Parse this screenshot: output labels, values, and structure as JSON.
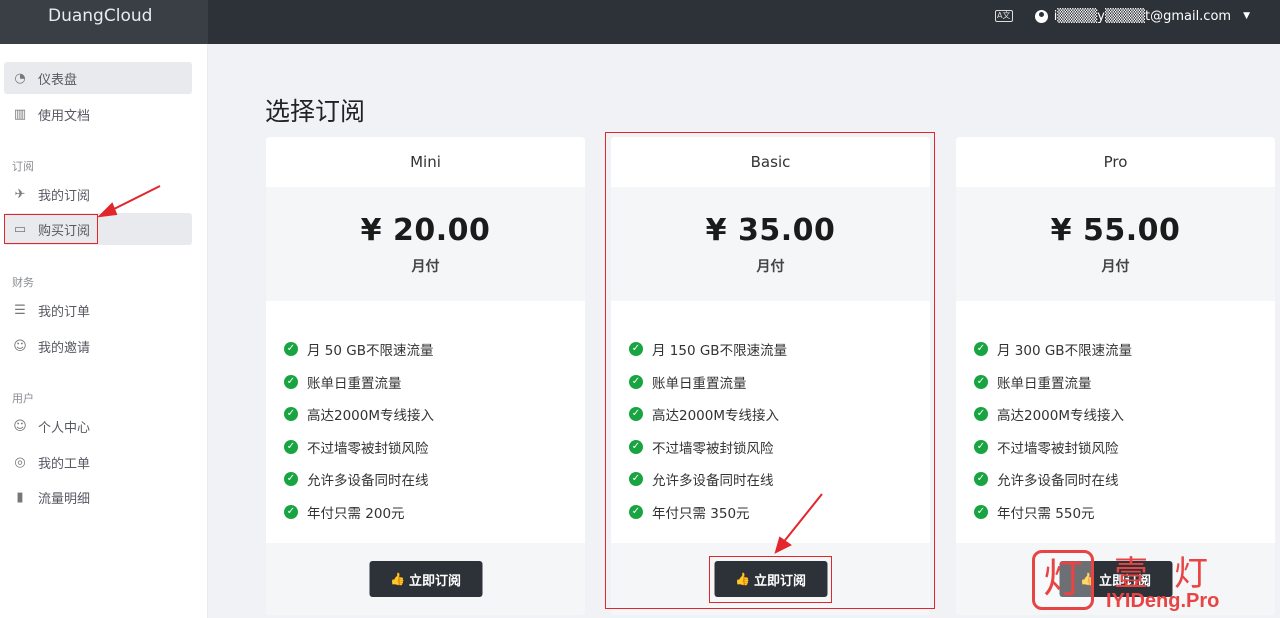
{
  "app": {
    "brand": "DuangCloud"
  },
  "header": {
    "lang_icon": "A文",
    "user_email": "i▒▒▒▒y▒▒▒▒t@gmail.com",
    "caret": "▼"
  },
  "sidebar": {
    "items": [
      {
        "label": "仪表盘",
        "icon": "gauge-icon",
        "glyph": "◔"
      },
      {
        "label": "使用文档",
        "icon": "book-icon",
        "glyph": "▥"
      },
      {
        "label": "我的订阅",
        "icon": "rocket-icon",
        "glyph": "✈"
      },
      {
        "label": "购买订阅",
        "icon": "clipboard-icon",
        "glyph": "▭"
      },
      {
        "label": "我的订单",
        "icon": "list-icon",
        "glyph": "☰"
      },
      {
        "label": "我的邀请",
        "icon": "users-icon",
        "glyph": "☺"
      },
      {
        "label": "个人中心",
        "icon": "user-icon",
        "glyph": "☺"
      },
      {
        "label": "我的工单",
        "icon": "support-icon",
        "glyph": "◎"
      },
      {
        "label": "流量明细",
        "icon": "bar-chart-icon",
        "glyph": "▮"
      }
    ],
    "sections": [
      "订阅",
      "财务",
      "用户"
    ]
  },
  "main": {
    "title": "选择订阅",
    "plans": [
      {
        "name": "Mini",
        "price": "¥ 20.00",
        "cycle": "月付",
        "features": [
          "月 50 GB不限速流量",
          "账单日重置流量",
          "高达2000M专线接入",
          "不过墙零被封锁风险",
          "允许多设备同时在线",
          "年付只需 200元"
        ],
        "button": "立即订阅"
      },
      {
        "name": "Basic",
        "price": "¥ 35.00",
        "cycle": "月付",
        "features": [
          "月 150 GB不限速流量",
          "账单日重置流量",
          "高达2000M专线接入",
          "不过墙零被封锁风险",
          "允许多设备同时在线",
          "年付只需 350元"
        ],
        "button": "立即订阅"
      },
      {
        "name": "Pro",
        "price": "¥ 55.00",
        "cycle": "月付",
        "features": [
          "月 300 GB不限速流量",
          "账单日重置流量",
          "高达2000M专线接入",
          "不过墙零被封锁风险",
          "允许多设备同时在线",
          "年付只需 550元"
        ],
        "button": "立即订阅"
      }
    ]
  },
  "watermark": {
    "logo_char": "灯",
    "cn": "壹灯",
    "en": "IYIDeng.Pro"
  },
  "colors": {
    "topbar": "#2d3239",
    "accent_red": "#e3262b",
    "check_green": "#19a442"
  }
}
